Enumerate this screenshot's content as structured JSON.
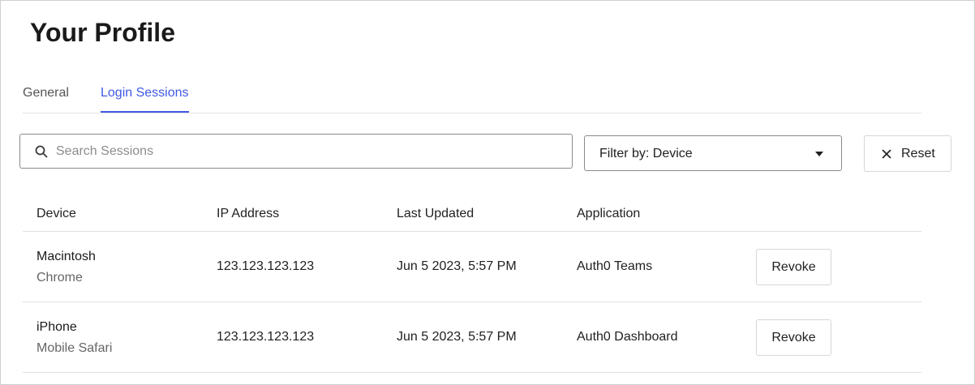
{
  "page": {
    "title": "Your Profile"
  },
  "tabs": [
    {
      "label": "General",
      "active": false
    },
    {
      "label": "Login Sessions",
      "active": true
    }
  ],
  "toolbar": {
    "search_placeholder": "Search Sessions",
    "search_value": "",
    "search_icon": "search-icon",
    "filter_label": "Filter by: Device",
    "filter_icon": "chevron-down-icon",
    "reset_label": "Reset",
    "reset_icon": "close-icon"
  },
  "table": {
    "columns": [
      "Device",
      "IP Address",
      "Last Updated",
      "Application"
    ],
    "rows": [
      {
        "device": "Macintosh",
        "browser": "Chrome",
        "ip": "123.123.123.123",
        "updated": "Jun 5 2023, 5:57 PM",
        "application": "Auth0 Teams",
        "action": "Revoke"
      },
      {
        "device": "iPhone",
        "browser": "Mobile Safari",
        "ip": "123.123.123.123",
        "updated": "Jun 5 2023, 5:57 PM",
        "application": "Auth0 Dashboard",
        "action": "Revoke"
      }
    ]
  },
  "colors": {
    "accent": "#3f59e4",
    "text": "#1f1f1f",
    "muted": "#666666",
    "border": "#e0e0e0"
  }
}
